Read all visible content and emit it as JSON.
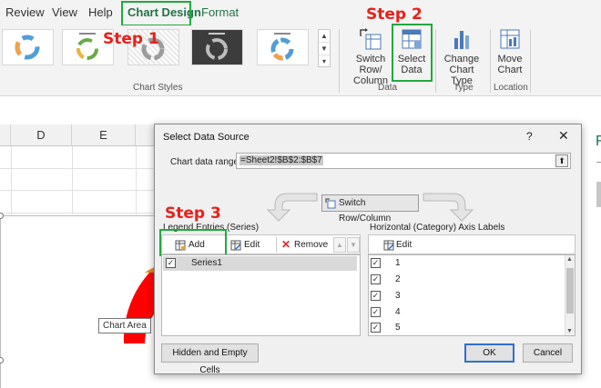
{
  "tabs": {
    "review": "Review",
    "view": "View",
    "help": "Help",
    "chart_design": "Chart Design",
    "format": "Format"
  },
  "ribbon": {
    "chart_styles_label": "Chart Styles",
    "data_group_label": "Data",
    "type_group_label": "Type",
    "location_group_label": "Location",
    "switch_row_col": [
      "Switch Row/",
      "Column"
    ],
    "select_data": [
      "Select",
      "Data"
    ],
    "change_chart_type": [
      "Change",
      "Chart Type"
    ],
    "move_chart": [
      "Move",
      "Chart"
    ]
  },
  "annotations": {
    "step1": "Step 1",
    "step2": "Step 2",
    "step3": "Step 3"
  },
  "sheet": {
    "col_d": "D",
    "col_e": "E",
    "tooltip": "Chart Area",
    "right_letter": "F"
  },
  "dialog": {
    "title": "Select Data Source",
    "help": "?",
    "close": "✕",
    "range_label": "Chart data range:",
    "range_value": "=Sheet2!$B$2:$B$7",
    "switch_label": "Switch Row/Column",
    "legend_label": "Legend Entries (Series)",
    "axis_label": "Horizontal (Category) Axis Labels",
    "add": "Add",
    "edit": "Edit",
    "remove": "Remove",
    "axis_edit": "Edit",
    "series": [
      "Series1"
    ],
    "axis_items": [
      "1",
      "2",
      "3",
      "4",
      "5"
    ],
    "hidden_cells": "Hidden and Empty Cells",
    "ok": "OK",
    "cancel": "Cancel"
  },
  "colors": {
    "accent_green": "#217346",
    "highlight_green": "#1faa3c",
    "step_red": "#e8201a",
    "chart_red": "#ff0000",
    "chart_orange": "#e8861f"
  }
}
